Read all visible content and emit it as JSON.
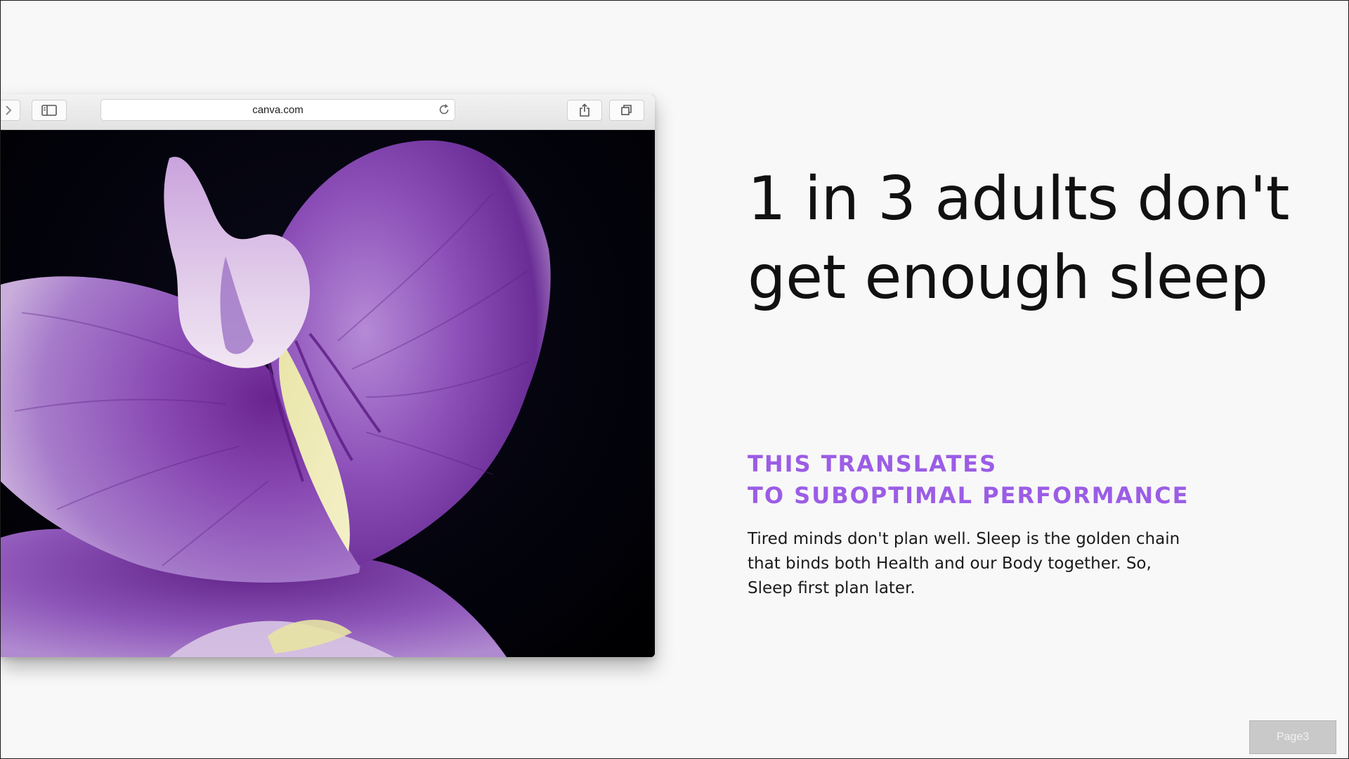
{
  "browser": {
    "address": "canva.com",
    "icons": {
      "forward": "chevron-right-icon",
      "sidebar": "sidebar-icon",
      "reload": "reload-icon",
      "share": "share-icon",
      "tabs": "tabs-icon"
    },
    "image": "purple-orchid-photo"
  },
  "slide": {
    "headline_line1": "1 in 3 adults don't",
    "headline_line2": "get enough sleep",
    "subhead_line1": "THIS TRANSLATES",
    "subhead_line2": "TO SUBOPTIMAL PERFORMANCE",
    "body": "Tired minds don't plan well. Sleep is the golden chain that binds both Health and our Body together. So, Sleep first plan later."
  },
  "page_button": "Page3",
  "colors": {
    "accent": "#9b5de5",
    "background": "#f8f8f8",
    "text": "#111111"
  }
}
